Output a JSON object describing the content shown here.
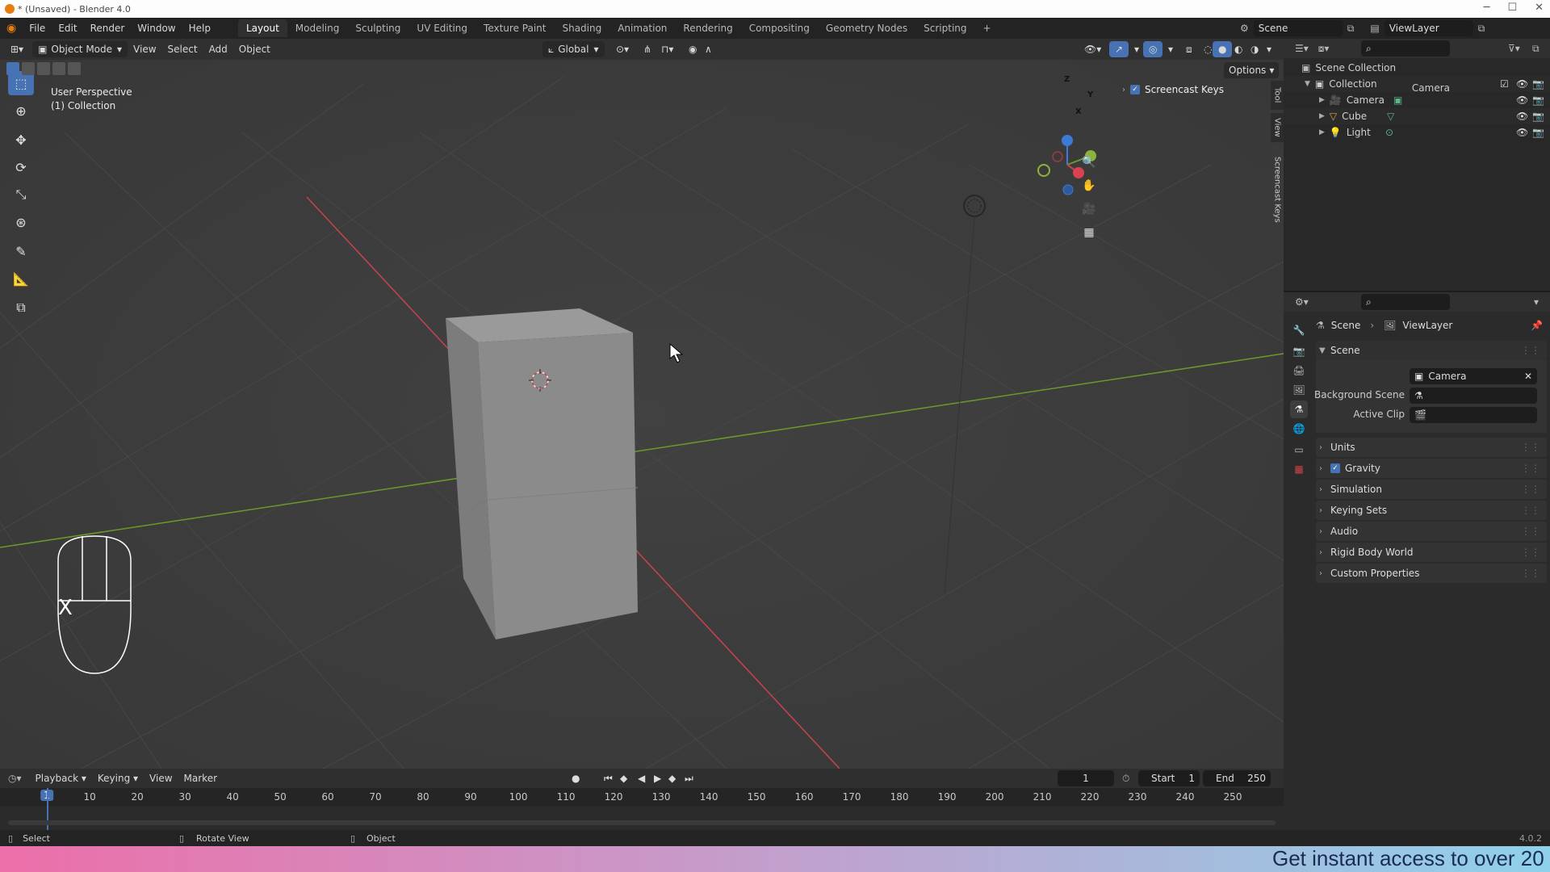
{
  "window": {
    "title": "* (Unsaved) - Blender 4.0",
    "controls": [
      "─",
      "☐",
      "✕"
    ]
  },
  "menu": {
    "items": [
      "File",
      "Edit",
      "Render",
      "Window",
      "Help"
    ]
  },
  "workspaces": {
    "tabs": [
      "Layout",
      "Modeling",
      "Sculpting",
      "UV Editing",
      "Texture Paint",
      "Shading",
      "Animation",
      "Rendering",
      "Compositing",
      "Geometry Nodes",
      "Scripting"
    ],
    "active": "Layout",
    "add": "+"
  },
  "scene_selector": {
    "value": "Scene"
  },
  "viewlayer_selector": {
    "value": "ViewLayer"
  },
  "viewport_header": {
    "mode": "Object Mode",
    "menus": [
      "View",
      "Select",
      "Add",
      "Object"
    ],
    "orientation": "Global",
    "options": "Options"
  },
  "viewport": {
    "overlay_line1": "User Perspective",
    "overlay_line2": "(1) Collection",
    "screencast_keys": "Screencast Keys",
    "key_display": "X",
    "sidebar_tabs": [
      "Tool",
      "View",
      "Screencast Keys"
    ],
    "gizmo_axes": [
      "Z",
      "Y",
      "X"
    ],
    "colors": {
      "x_axis": "#c7434f",
      "y_axis": "#6a9a2a",
      "z_axis": "#3d7ad8",
      "cube": "#8a8a8a"
    }
  },
  "outliner": {
    "root": "Scene Collection",
    "collection": "Collection",
    "objects": [
      "Camera",
      "Cube",
      "Light"
    ]
  },
  "properties": {
    "breadcrumb": [
      "Scene",
      "ViewLayer"
    ],
    "panel_title": "Scene",
    "fields": [
      {
        "label": "Camera",
        "value": "Camera"
      },
      {
        "label": "Background Scene",
        "value": ""
      },
      {
        "label": "Active Clip",
        "value": ""
      }
    ],
    "panels": [
      "Units",
      "Gravity",
      "Simulation",
      "Keying Sets",
      "Audio",
      "Rigid Body World",
      "Custom Properties"
    ]
  },
  "timeline": {
    "menus": [
      "Playback",
      "Keying",
      "View",
      "Marker"
    ],
    "current_frame": "1",
    "start_label": "Start",
    "start": "1",
    "end_label": "End",
    "end": "250",
    "ruler": [
      "1",
      "10",
      "20",
      "30",
      "40",
      "50",
      "60",
      "70",
      "80",
      "90",
      "100",
      "110",
      "120",
      "130",
      "140",
      "150",
      "160",
      "170",
      "180",
      "190",
      "200",
      "210",
      "220",
      "230",
      "240",
      "250"
    ]
  },
  "statusbar": {
    "items": [
      "Select",
      "Rotate View",
      "Object"
    ],
    "version": "4.0.2"
  },
  "banner": {
    "text": "Get instant access to over 20"
  }
}
